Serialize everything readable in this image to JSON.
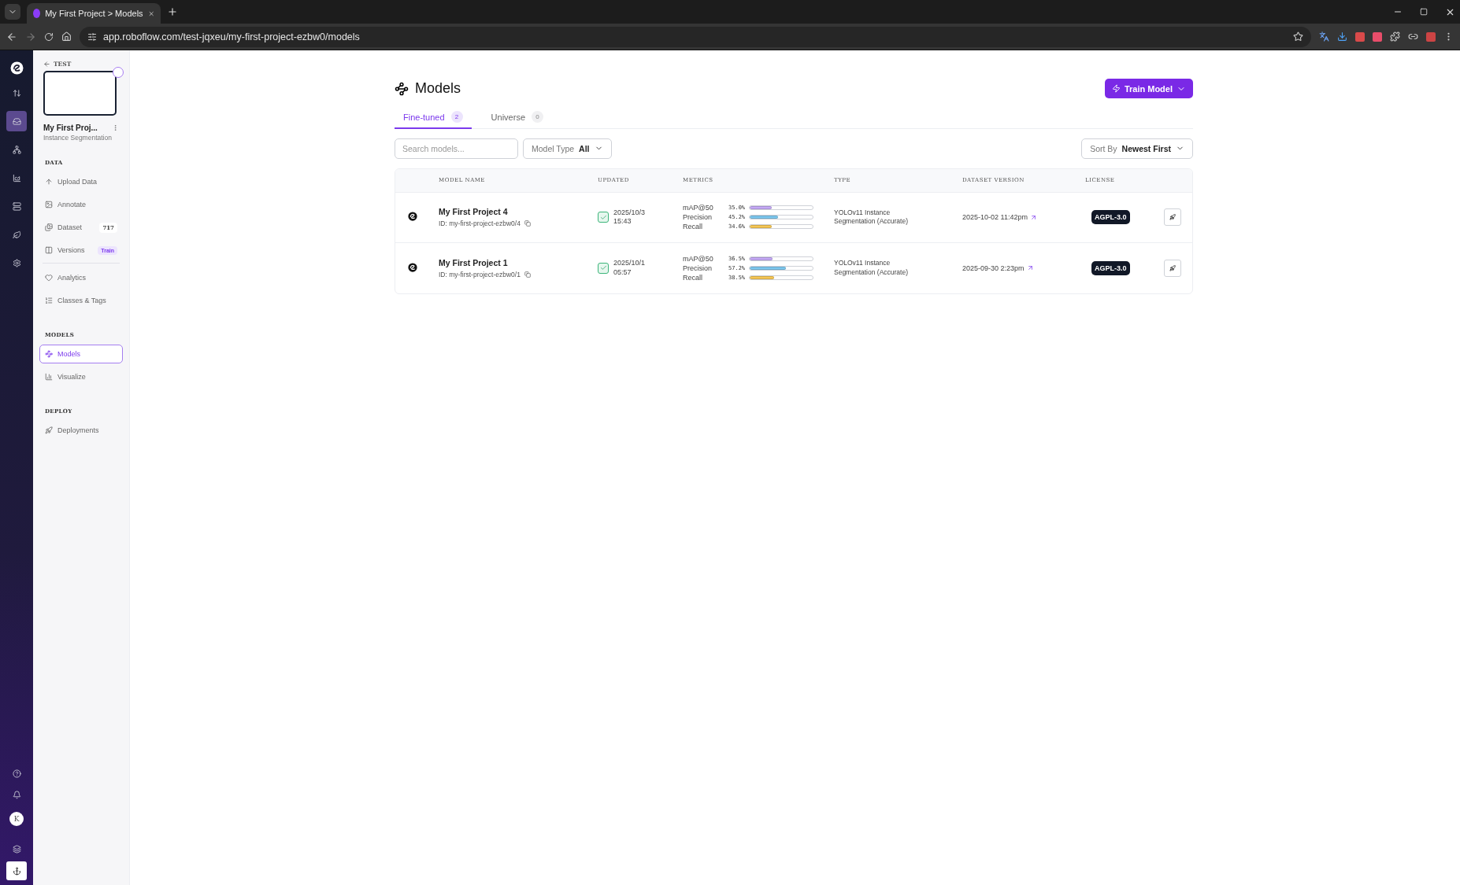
{
  "browser": {
    "tab_title": "My First Project > Models",
    "url": "app.roboflow.com/test-jqxeu/my-first-project-ezbw0/models"
  },
  "rail": {
    "items": [
      {
        "selected": false
      },
      {
        "selected": true
      },
      {
        "selected": false
      },
      {
        "selected": false
      },
      {
        "selected": false
      },
      {
        "selected": false
      },
      {
        "selected": false
      }
    ],
    "avatar": "K"
  },
  "sidebar": {
    "back_label": "TEST",
    "project_name": "My First Proj...",
    "project_type": "Instance Segmentation",
    "sections": [
      {
        "heading": "DATA",
        "groups": [
          [
            {
              "label": "Upload Data",
              "selected": false
            },
            {
              "label": "Annotate",
              "selected": false
            },
            {
              "label": "Dataset",
              "selected": false,
              "badge": {
                "text": "717",
                "kind": "count"
              }
            },
            {
              "label": "Versions",
              "selected": false,
              "badge": {
                "text": "Train",
                "kind": "action"
              }
            }
          ],
          [
            {
              "label": "Analytics",
              "selected": false
            },
            {
              "label": "Classes & Tags",
              "selected": false
            }
          ]
        ]
      },
      {
        "heading": "MODELS",
        "groups": [
          [
            {
              "label": "Models",
              "selected": true
            },
            {
              "label": "Visualize",
              "selected": false
            }
          ]
        ]
      },
      {
        "heading": "DEPLOY",
        "groups": [
          [
            {
              "label": "Deployments",
              "selected": false
            }
          ]
        ]
      }
    ]
  },
  "main": {
    "title": "Models",
    "train_button": "Train Model",
    "tabs": [
      {
        "label": "Fine-tuned",
        "count": "2",
        "selected": true
      },
      {
        "label": "Universe",
        "count": "0",
        "selected": false
      }
    ],
    "search": {
      "placeholder": "Search models..."
    },
    "model_type": {
      "label": "Model Type",
      "value": "All"
    },
    "sort": {
      "label": "Sort By",
      "value": "Newest First"
    },
    "table": {
      "columns": [
        "MODEL NAME",
        "UPDATED",
        "METRICS",
        "TYPE",
        "DATASET VERSION",
        "LICENSE"
      ],
      "rows": [
        {
          "name": "My First Project 4",
          "id": "ID: my-first-project-ezbw0/4",
          "date": "2025/10/3",
          "time": "15:43",
          "metrics": [
            {
              "label": "mAP@50",
              "reading": "35.0%",
              "level": 0.35,
              "color": "#c4a8f5"
            },
            {
              "label": "Precision",
              "reading": "45.2%",
              "level": 0.452,
              "color": "#7cc7ee"
            },
            {
              "label": "Recall",
              "reading": "34.6%",
              "level": 0.346,
              "color": "#f5c654"
            }
          ],
          "type": "YOLOv11 Instance Segmentation (Accurate)",
          "dataset_version": "2025-10-02 11:42pm",
          "license": "AGPL-3.0"
        },
        {
          "name": "My First Project 1",
          "id": "ID: my-first-project-ezbw0/1",
          "date": "2025/10/1",
          "time": "05:57",
          "metrics": [
            {
              "label": "mAP@50",
              "reading": "36.5%",
              "level": 0.365,
              "color": "#c4a8f5"
            },
            {
              "label": "Precision",
              "reading": "57.2%",
              "level": 0.572,
              "color": "#7cc7ee"
            },
            {
              "label": "Recall",
              "reading": "38.5%",
              "level": 0.385,
              "color": "#f5c654"
            }
          ],
          "type": "YOLOv11 Instance Segmentation (Accurate)",
          "dataset_version": "2025-09-30 2:23pm",
          "license": "AGPL-3.0"
        }
      ]
    }
  }
}
